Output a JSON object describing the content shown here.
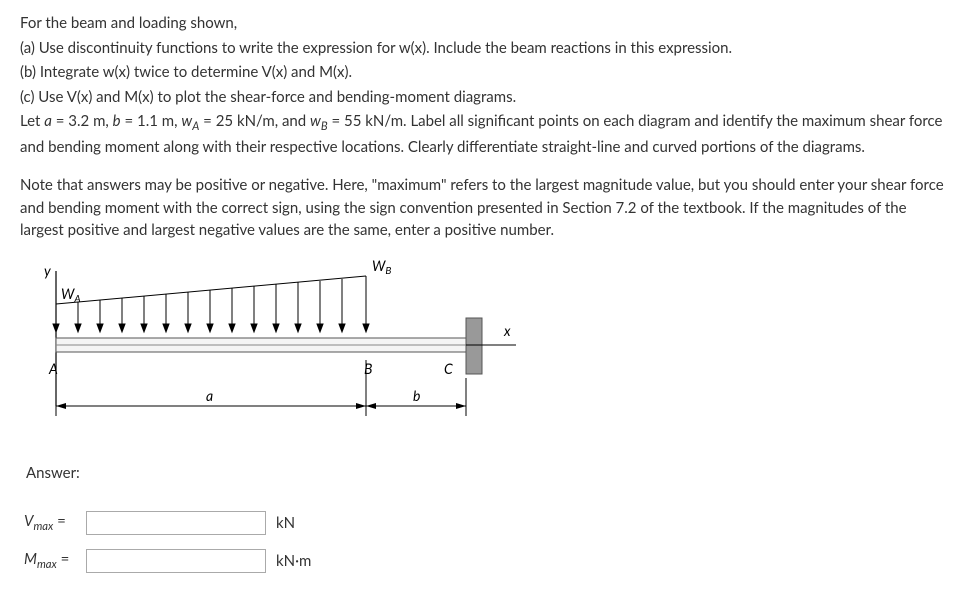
{
  "problem": {
    "intro": "For the beam and loading shown,",
    "part_a": "(a) Use discontinuity functions to write the expression for w(x). Include the beam reactions in this expression.",
    "part_b": "(b) Integrate w(x) twice to determine V(x) and M(x).",
    "part_c": "(c) Use V(x) and M(x) to plot the shear-force and bending-moment diagrams.",
    "params_prefix": "Let ",
    "a_lbl": "a",
    "a_val": " = 3.2 m, ",
    "b_lbl": "b",
    "b_val": " = 1.1 m, ",
    "wA_lbl": "w",
    "wA_sub": "A",
    "wA_val": " = 25 kN/m, and ",
    "wB_lbl": "w",
    "wB_sub": "B",
    "wB_val": " = 55 kN/m. Label all significant points on each diagram and identify the maximum shear force and bending moment along with their respective locations. Clearly differentiate straight-line and curved portions of the diagrams.",
    "note": "Note that answers may be positive or negative. Here, \"maximum\" refers to the largest magnitude value, but you should enter your shear force and bending moment with the correct sign, using the sign convention presented in Section 7.2 of the textbook. If the magnitudes of the largest positive and largest negative values are the same, enter a positive number."
  },
  "diagram": {
    "y": "y",
    "wA": "W",
    "wA_sub": "A",
    "wB": "W",
    "wB_sub": "B",
    "A": "A",
    "B": "B",
    "C": "C",
    "x": "x",
    "a": "a",
    "b": "b"
  },
  "answer": {
    "label": "Answer:",
    "vmax_lbl_main": "V",
    "vmax_lbl_sub": "max",
    "eq": " =",
    "mmax_lbl_main": "M",
    "mmax_lbl_sub": "max",
    "v_unit": "kN",
    "m_unit": "kN·m"
  }
}
